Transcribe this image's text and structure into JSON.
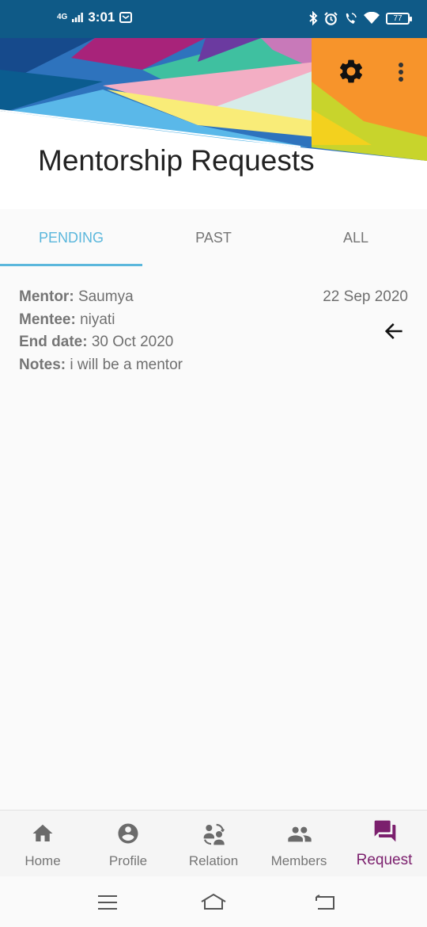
{
  "status_bar": {
    "network": "4G",
    "time": "3:01",
    "battery": "77"
  },
  "header": {
    "title": "Mentorship Requests",
    "settings_icon": "gear-icon",
    "overflow_icon": "more-vert-icon"
  },
  "tabs": [
    {
      "label": "PENDING",
      "active": true
    },
    {
      "label": "PAST",
      "active": false
    },
    {
      "label": "ALL",
      "active": false
    }
  ],
  "requests": [
    {
      "mentor_label": "Mentor:",
      "mentor": "Saumya",
      "mentee_label": "Mentee:",
      "mentee": "niyati",
      "end_date_label": "End date:",
      "end_date": "30 Oct 2020",
      "notes_label": "Notes:",
      "notes": "i will be a mentor",
      "date": "22 Sep 2020",
      "direction_icon": "arrow-left-icon"
    }
  ],
  "bottom_nav": [
    {
      "label": "Home",
      "icon": "home-icon",
      "active": false
    },
    {
      "label": "Profile",
      "icon": "account-circle-icon",
      "active": false
    },
    {
      "label": "Relation",
      "icon": "relation-icon",
      "active": false
    },
    {
      "label": "Members",
      "icon": "people-icon",
      "active": false
    },
    {
      "label": "Request",
      "icon": "forum-icon",
      "active": true
    }
  ],
  "colors": {
    "status_bar": "#0f5a87",
    "tab_active": "#5bb7dc",
    "nav_active": "#7b1f6d",
    "nav_inactive": "#757575"
  }
}
